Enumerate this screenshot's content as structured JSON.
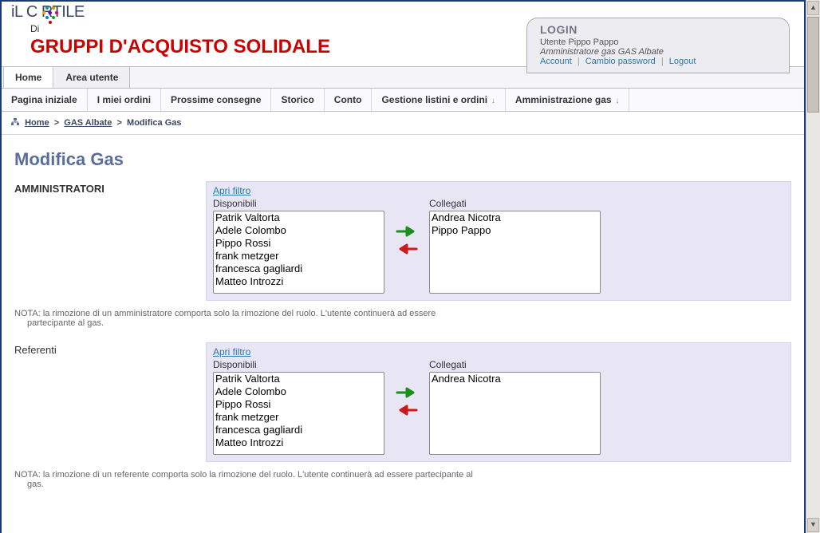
{
  "logo": {
    "prefix": "iL C",
    "suffix": "RTILE",
    "di": "Di"
  },
  "site_title": "GRUPPI D'ACQUISTO SOLIDALE",
  "login": {
    "heading": "LOGIN",
    "user_line": "Utente Pippo Pappo",
    "role_line": "Amministratore gas GAS Albate",
    "account": "Account",
    "change_pw": "Cambio password",
    "logout": "Logout"
  },
  "topnav": [
    {
      "label": "Home"
    },
    {
      "label": "Area utente"
    }
  ],
  "subnav": [
    {
      "label": "Pagina iniziale"
    },
    {
      "label": "I miei ordini"
    },
    {
      "label": "Prossime consegne"
    },
    {
      "label": "Storico"
    },
    {
      "label": "Conto"
    },
    {
      "label": "Gestione listini e ordini",
      "dd": true
    },
    {
      "label": "Amministrazione gas",
      "dd": true
    }
  ],
  "breadcrumb": {
    "home": "Home",
    "mid": "GAS Albate",
    "cur": "Modifica Gas"
  },
  "page_title": "Modifica Gas",
  "sections": {
    "admins": {
      "label": "AMMINISTRATORI",
      "filter": "Apri filtro",
      "avail_label": "Disponibili",
      "linked_label": "Collegati",
      "available": [
        "Patrik Valtorta",
        "Adele Colombo",
        "Pippo Rossi",
        "frank metzger",
        "francesca gagliardi",
        "Matteo Introzzi"
      ],
      "linked": [
        "Andrea Nicotra",
        "Pippo Pappo"
      ],
      "note_a": "NOTA: la rimozione di un amministratore comporta solo la rimozione del ruolo. L'utente continuerà ad essere",
      "note_b": "partecipante al gas."
    },
    "refs": {
      "label": "Referenti",
      "filter": "Apri filtro",
      "avail_label": "Disponibili",
      "linked_label": "Collegati",
      "available": [
        "Patrik Valtorta",
        "Adele Colombo",
        "Pippo Rossi",
        "frank metzger",
        "francesca gagliardi",
        "Matteo Introzzi"
      ],
      "linked": [
        "Andrea Nicotra"
      ],
      "note_a": "NOTA: la rimozione di un referente comporta solo la rimozione del ruolo. L'utente continuerà ad essere partecipante al",
      "note_b": "gas."
    }
  }
}
